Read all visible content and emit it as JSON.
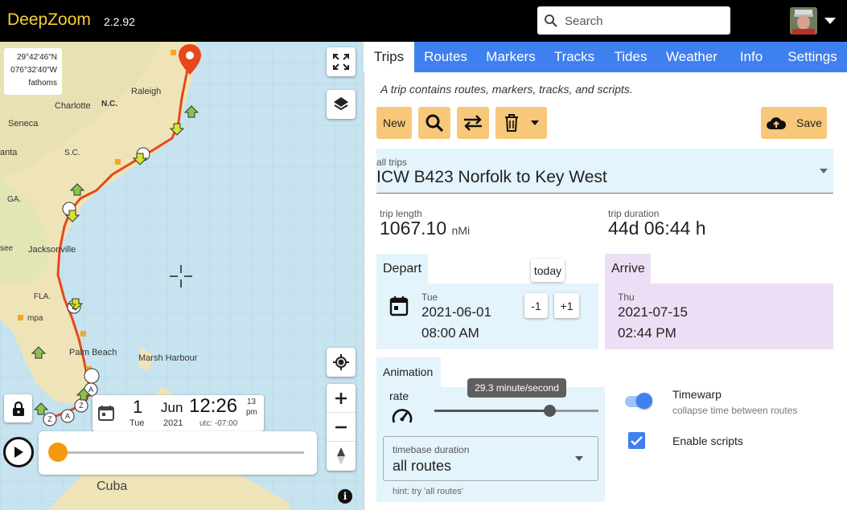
{
  "app": {
    "name": "DeepZoom",
    "version": "2.2.92"
  },
  "search": {
    "placeholder": "Search"
  },
  "map": {
    "coords": {
      "lat": "29°42'46\"N",
      "lon": "076°32'40\"W",
      "unit": "fathoms"
    },
    "labels": [
      "Raleigh",
      "N.C.",
      "Charlotte",
      "Seneca",
      "S.C.",
      "anta",
      "GA.",
      "see",
      "Jacksonville",
      "FLA.",
      "mpa",
      "Palm Beach",
      "Marsh Harbour",
      "Cuba"
    ],
    "time": {
      "day": "1",
      "weekday": "Tue",
      "month": "Jun",
      "year": "2021",
      "clock": "12:26",
      "seconds": "13",
      "ampm": "pm",
      "utc": "utc: -07:00"
    },
    "playback_progress": 0.0
  },
  "tabs": [
    "Trips",
    "Routes",
    "Markers",
    "Tracks",
    "Tides",
    "Weather",
    "Info",
    "Settings"
  ],
  "active_tab": "Trips",
  "trips": {
    "subtitle": "A trip contains routes, markers, tracks, and scripts.",
    "new_label": "New",
    "save_label": "Save",
    "select_label": "all trips",
    "select_value": "ICW B423 Norfolk to Key West",
    "length_label": "trip length",
    "length_value": "1067.10",
    "length_unit": "nMi",
    "duration_label": "trip duration",
    "duration_value": "44d 06:44 h",
    "depart": {
      "label": "Depart",
      "weekday": "Tue",
      "date": "2021-06-01",
      "time": "08:00 AM",
      "today_label": "today",
      "minus_label": "-1",
      "plus_label": "+1"
    },
    "arrive": {
      "label": "Arrive",
      "weekday": "Thu",
      "date": "2021-07-15",
      "time": "02:44 PM"
    },
    "animation": {
      "label": "Animation",
      "rate_label": "rate",
      "rate_tooltip": "29.3 minute/second",
      "rate_fraction": 0.7,
      "timebase_label": "timebase duration",
      "timebase_value": "all routes",
      "hint": "hint: try 'all routes'"
    },
    "timewarp": {
      "label": "Timewarp",
      "sub": "collapse time between routes",
      "on": true
    },
    "scripts": {
      "label": "Enable scripts",
      "checked": true
    }
  },
  "colors": {
    "accent": "#3f80f0",
    "button": "#f8c87a",
    "route": "#e8471a",
    "depart_bg": "#e3f4fc",
    "arrive_bg": "#ecdff5"
  }
}
